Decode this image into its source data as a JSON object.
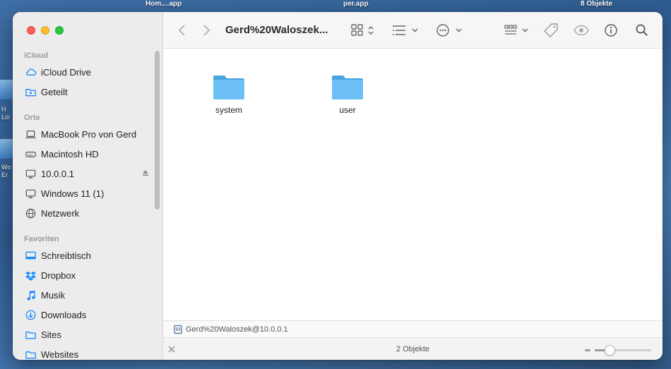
{
  "desktop": {
    "top_labels": [
      "Hom....app",
      "per.app",
      "8 Objekte"
    ],
    "side_labels": [
      "H",
      "Loi",
      "Wo",
      "Er"
    ]
  },
  "sidebar": {
    "sections": [
      {
        "title": "iCloud",
        "items": [
          {
            "label": "iCloud Drive",
            "icon": "cloud-icon"
          },
          {
            "label": "Geteilt",
            "icon": "shared-folder-icon"
          }
        ]
      },
      {
        "title": "Orte",
        "items": [
          {
            "label": "MacBook Pro von Gerd",
            "icon": "laptop-icon"
          },
          {
            "label": "Macintosh HD",
            "icon": "disk-icon"
          },
          {
            "label": "10.0.0.1",
            "icon": "monitor-icon",
            "eject": true
          },
          {
            "label": "Windows 11 (1)",
            "icon": "monitor-icon"
          },
          {
            "label": "Netzwerk",
            "icon": "network-icon"
          }
        ]
      },
      {
        "title": "Favoriten",
        "items": [
          {
            "label": "Schreibtisch",
            "icon": "desktop-icon"
          },
          {
            "label": "Dropbox",
            "icon": "dropbox-icon"
          },
          {
            "label": "Musik",
            "icon": "music-icon"
          },
          {
            "label": "Downloads",
            "icon": "download-icon"
          },
          {
            "label": "Sites",
            "icon": "folder-icon"
          },
          {
            "label": "Websites",
            "icon": "folder-icon"
          }
        ]
      }
    ]
  },
  "toolbar": {
    "title": "Gerd%20Waloszek..."
  },
  "content": {
    "folders": [
      {
        "name": "system"
      },
      {
        "name": "user"
      }
    ]
  },
  "pathbar": {
    "text": "Gerd%20Waloszek@10.0.0.1"
  },
  "status": {
    "text": "2 Objekte",
    "zoom_fraction": 0.22
  },
  "colors": {
    "accent": "#1a8cff",
    "folder": "#5ab8f0",
    "sidebar_icon": "#1a8cff"
  }
}
